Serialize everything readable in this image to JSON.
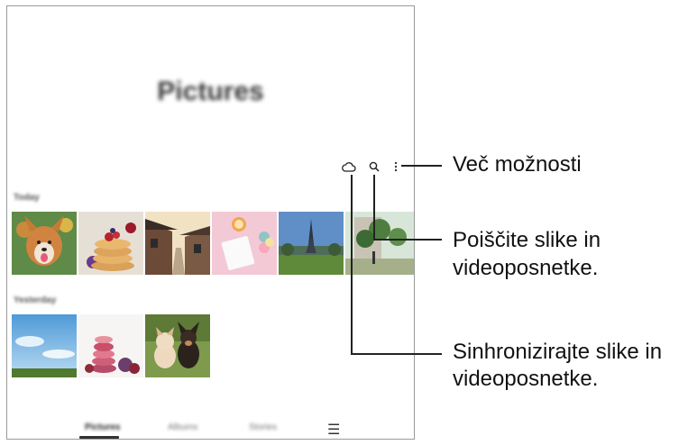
{
  "app": {
    "title": "Pictures",
    "sections": [
      {
        "label": "Today"
      },
      {
        "label": "Yesterday"
      }
    ],
    "toolbar": {
      "cloud_icon": "cloud-icon",
      "search_icon": "search-icon",
      "more_icon": "more-options-icon"
    },
    "bottom_nav": {
      "items": [
        {
          "label": "Pictures"
        },
        {
          "label": "Albums"
        },
        {
          "label": "Stories"
        }
      ],
      "menu_glyph": "☰"
    }
  },
  "callouts": [
    {
      "text": "Več možnosti"
    },
    {
      "line1": "Poiščite slike in",
      "line2": "videoposnetke."
    },
    {
      "line1": "Sinhronizirajte slike in",
      "line2": "videoposnetke."
    }
  ],
  "colors": {
    "line": "#222222",
    "frame": "#9a9a9a"
  }
}
